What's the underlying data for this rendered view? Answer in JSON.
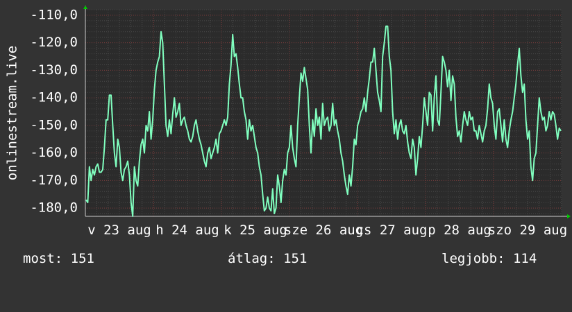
{
  "chart_data": {
    "type": "line",
    "ylabel": "onlinestream.live",
    "x_tick_labels": [
      "v 23 aug",
      "h 24 aug",
      "k 25 aug",
      "sze 26 aug",
      "cs 27 aug",
      "p 28 aug",
      "szo 29 aug"
    ],
    "y_tick_labels": [
      "-110,0",
      "-120,0",
      "-130,0",
      "-140,0",
      "-150,0",
      "-160,0",
      "-170,0",
      "-180,0"
    ],
    "ylim": [
      -183,
      -108
    ],
    "y_ticks": [
      -110,
      -120,
      -130,
      -140,
      -150,
      -160,
      -170,
      -180
    ],
    "grid": true,
    "series": [
      {
        "color": "#80ffbf",
        "x_range": [
          0,
          7
        ],
        "values": [
          -177,
          -178,
          -165,
          -170,
          -166,
          -168,
          -165,
          -164,
          -167,
          -167,
          -166,
          -158,
          -148,
          -148,
          -139,
          -139,
          -150,
          -160,
          -165,
          -155,
          -158,
          -167,
          -170,
          -166,
          -165,
          -163,
          -168,
          -178,
          -183,
          -165,
          -170,
          -172,
          -163,
          -157,
          -155,
          -160,
          -150,
          -152,
          -145,
          -155,
          -148,
          -137,
          -130,
          -127,
          -125,
          -116,
          -120,
          -135,
          -150,
          -154,
          -148,
          -153,
          -146,
          -140,
          -147,
          -145,
          -142,
          -150,
          -148,
          -147,
          -150,
          -152,
          -155,
          -156,
          -154,
          -150,
          -148,
          -152,
          -155,
          -157,
          -160,
          -163,
          -165,
          -160,
          -158,
          -162,
          -160,
          -158,
          -155,
          -160,
          -153,
          -152,
          -150,
          -148,
          -150,
          -147,
          -135,
          -128,
          -117,
          -125,
          -124,
          -129,
          -135,
          -140,
          -140,
          -145,
          -148,
          -155,
          -148,
          -152,
          -150,
          -154,
          -158,
          -160,
          -165,
          -168,
          -175,
          -181,
          -180,
          -176,
          -180,
          -181,
          -173,
          -182,
          -180,
          -168,
          -172,
          -178,
          -170,
          -166,
          -168,
          -160,
          -158,
          -150,
          -158,
          -162,
          -165,
          -150,
          -140,
          -131,
          -134,
          -129,
          -133,
          -137,
          -150,
          -160,
          -148,
          -154,
          -144,
          -150,
          -147,
          -155,
          -142,
          -150,
          -148,
          -147,
          -152,
          -150,
          -142,
          -150,
          -148,
          -152,
          -155,
          -160,
          -163,
          -168,
          -172,
          -175,
          -168,
          -172,
          -165,
          -155,
          -157,
          -150,
          -148,
          -145,
          -144,
          -140,
          -145,
          -138,
          -133,
          -127,
          -127,
          -122,
          -130,
          -138,
          -141,
          -145,
          -125,
          -120,
          -114,
          -114,
          -125,
          -130,
          -145,
          -153,
          -148,
          -155,
          -150,
          -148,
          -152,
          -153,
          -150,
          -156,
          -160,
          -162,
          -155,
          -158,
          -168,
          -162,
          -154,
          -158,
          -150,
          -140,
          -145,
          -150,
          -138,
          -139,
          -152,
          -140,
          -132,
          -148,
          -150,
          -138,
          -125,
          -127,
          -130,
          -136,
          -130,
          -141,
          -132,
          -135,
          -147,
          -154,
          -152,
          -156,
          -150,
          -145,
          -148,
          -150,
          -145,
          -148,
          -147,
          -152,
          -152,
          -155,
          -150,
          -153,
          -156,
          -152,
          -150,
          -144,
          -135,
          -140,
          -142,
          -150,
          -155,
          -145,
          -144,
          -150,
          -156,
          -148,
          -155,
          -158,
          -152,
          -148,
          -145,
          -140,
          -135,
          -128,
          -122,
          -132,
          -138,
          -135,
          -148,
          -155,
          -152,
          -165,
          -170,
          -162,
          -160,
          -150,
          -140,
          -145,
          -148,
          -147,
          -152,
          -150,
          -145,
          -148,
          -145,
          -146,
          -150,
          -155,
          -151,
          -152
        ]
      }
    ]
  },
  "stats": {
    "now": "most: 151",
    "avg": "átlag: 151",
    "max": "legjobb: 114"
  }
}
